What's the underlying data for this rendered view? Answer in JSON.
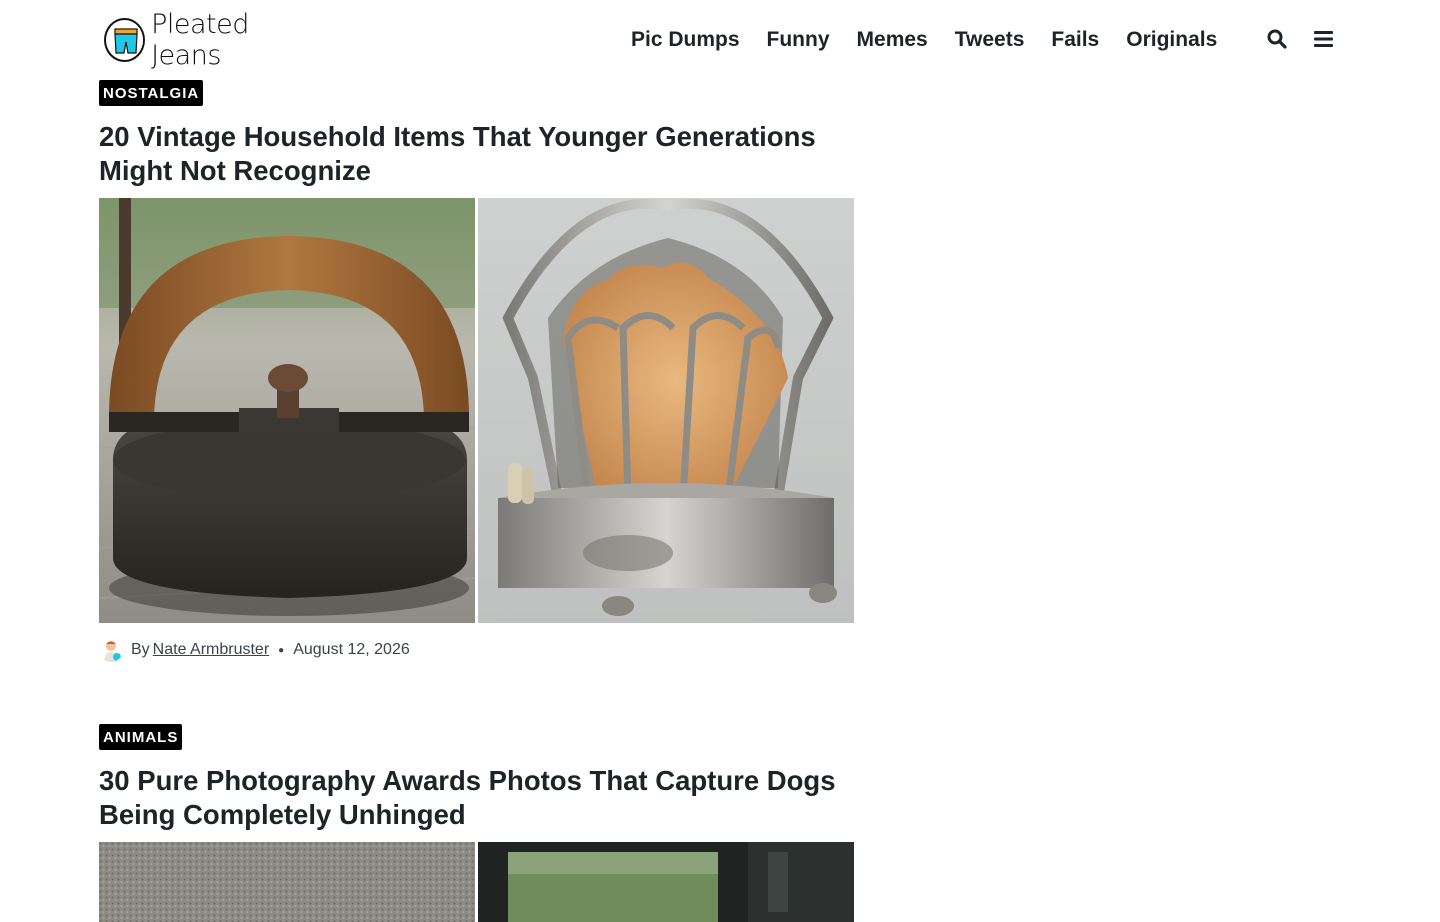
{
  "site": {
    "name": "Pleated Jeans"
  },
  "nav": {
    "items": [
      "Pic Dumps",
      "Funny",
      "Memes",
      "Tweets",
      "Fails",
      "Originals"
    ],
    "icons": [
      "search-icon",
      "menu-icon"
    ]
  },
  "articles": [
    {
      "category": "NOSTALGIA",
      "title": "20 Vintage Household Items That Younger Generations Might Not Recognize",
      "author_prefix": "By",
      "author": "Nate Armbruster",
      "date": "August 12, 2026"
    },
    {
      "category": "ANIMALS",
      "title": "30 Pure Photography Awards Photos That Capture Dogs Being Completely Unhinged"
    }
  ],
  "colors": {
    "badge_bg": "#000000",
    "text": "#1d2327",
    "logo_accent": "#1ec8e6",
    "logo_waist": "#f5a623"
  }
}
